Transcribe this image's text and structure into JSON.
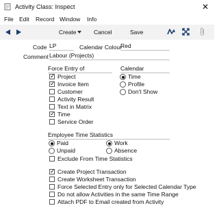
{
  "window": {
    "title": "Activity Class: Inspect"
  },
  "menu": [
    "File",
    "Edit",
    "Record",
    "Window",
    "Info"
  ],
  "toolbar": {
    "create": "Create",
    "cancel": "Cancel",
    "save": "Save"
  },
  "fields": {
    "code_label": "Code",
    "code_value": "LP",
    "calendar_colour_label": "Calendar Colour",
    "calendar_colour_value": "Red",
    "comment_label": "Comment",
    "comment_value": "Labour (Projects)"
  },
  "force_entry": {
    "heading": "Force Entry of",
    "items": [
      {
        "label": "Project",
        "checked": true
      },
      {
        "label": "Invoice Item",
        "checked": true
      },
      {
        "label": "Customer",
        "checked": false
      },
      {
        "label": "Activity Result",
        "checked": false
      },
      {
        "label": "Text in Matrix",
        "checked": false
      },
      {
        "label": "Time",
        "checked": true
      },
      {
        "label": "Service Order",
        "checked": false
      }
    ]
  },
  "calendar": {
    "heading": "Calendar",
    "options": [
      {
        "label": "Time",
        "selected": true
      },
      {
        "label": "Profile",
        "selected": false
      },
      {
        "label": "Don't Show",
        "selected": false
      }
    ]
  },
  "employee_time": {
    "heading": "Employee Time Statistics",
    "left": [
      {
        "label": "Paid",
        "selected": true
      },
      {
        "label": "Unpaid",
        "selected": false
      }
    ],
    "right": [
      {
        "label": "Work",
        "selected": true
      },
      {
        "label": "Absence",
        "selected": false
      }
    ],
    "exclude_label": "Exclude From Time Statistics",
    "exclude_checked": false
  },
  "options": [
    {
      "label": "Create Project Transaction",
      "checked": true
    },
    {
      "label": "Create Worksheet Transaction",
      "checked": false
    },
    {
      "label": "Force Selected Entry only for Selected Calendar Type",
      "checked": false
    },
    {
      "label": "Do not allow Activities in the same Time Range",
      "checked": false
    },
    {
      "label": "Attach PDF to Email created from Activity",
      "checked": false
    }
  ]
}
